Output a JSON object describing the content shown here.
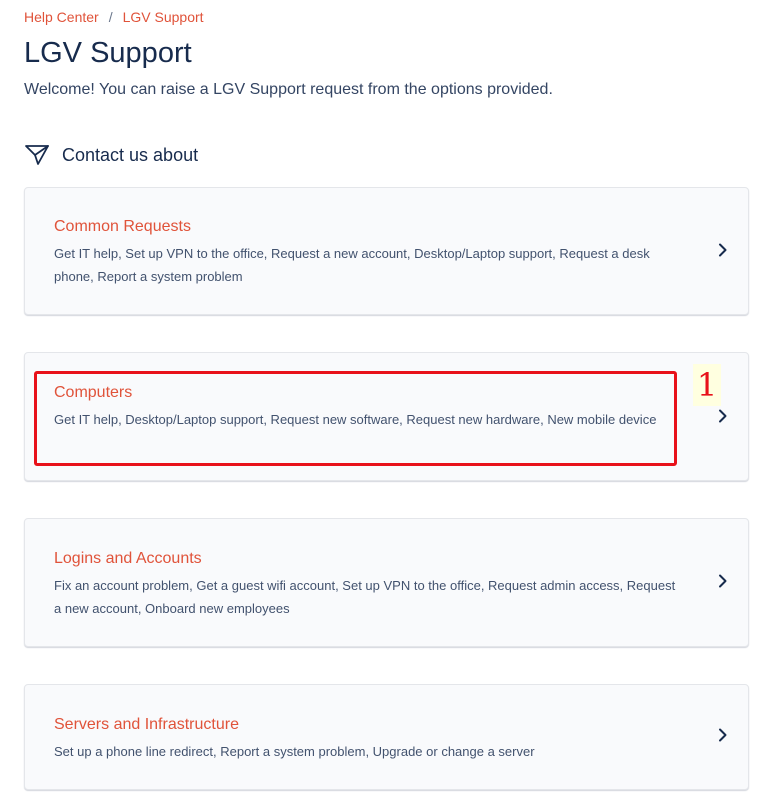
{
  "breadcrumb": {
    "items": [
      "Help Center",
      "LGV Support"
    ],
    "separator": "/"
  },
  "page": {
    "title": "LGV Support",
    "welcome": "Welcome! You can raise a LGV Support request from the options provided."
  },
  "contact": {
    "title": "Contact us about",
    "icon": "send-icon"
  },
  "cards": [
    {
      "title": "Common Requests",
      "description": "Get IT help, Set up VPN to the office, Request a new account, Desktop/Laptop support, Request a desk phone, Report a system problem"
    },
    {
      "title": "Computers",
      "description": "Get IT help, Desktop/Laptop support, Request new software, Request new hardware, New mobile device"
    },
    {
      "title": "Logins and Accounts",
      "description": "Fix an account problem, Get a guest wifi account, Set up VPN to the office, Request admin access, Request a new account, Onboard new employees"
    },
    {
      "title": "Servers and Infrastructure",
      "description": "Set up a phone line redirect, Report a system problem, Upgrade or change a server"
    }
  ],
  "annotation": {
    "label": "1",
    "color": "#e8111a"
  },
  "colors": {
    "accent": "#e0533a",
    "heading": "#172b4d",
    "card_bg": "#f9fafc"
  }
}
